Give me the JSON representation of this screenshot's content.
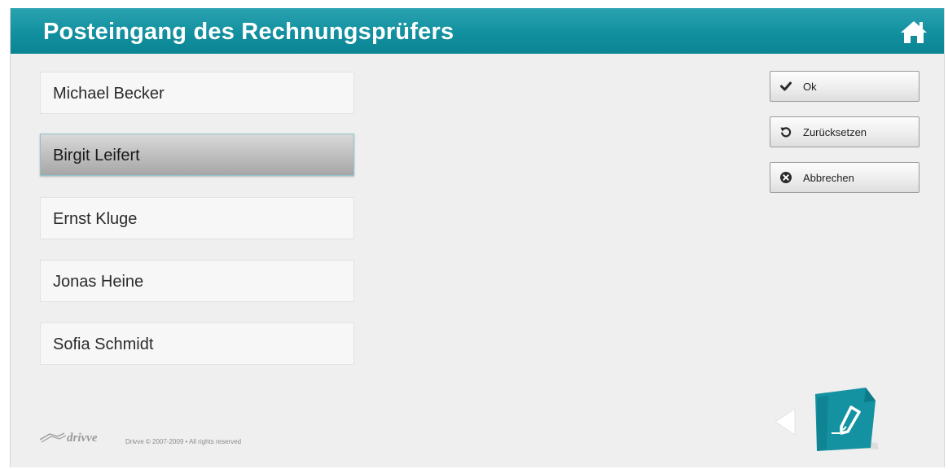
{
  "header": {
    "title": "Posteingang des Rechnungsprüfers",
    "accent_color": "#12909f",
    "home_icon": "home-icon"
  },
  "recipients": [
    {
      "name": "Michael Becker",
      "selected": false
    },
    {
      "name": "Birgit Leifert",
      "selected": true
    },
    {
      "name": "Ernst Kluge",
      "selected": false
    },
    {
      "name": "Jonas Heine",
      "selected": false
    },
    {
      "name": "Sofia Schmidt",
      "selected": false
    }
  ],
  "actions": {
    "ok": {
      "label": "Ok",
      "icon": "checkmark-icon"
    },
    "reset": {
      "label": "Zurücksetzen",
      "icon": "undo-icon"
    },
    "cancel": {
      "label": "Abbrechen",
      "icon": "close-circle-icon"
    }
  },
  "footer": {
    "brand": "drivve",
    "copyright": "Drivve © 2007-2009 • All rights reserved"
  },
  "navigation": {
    "back_icon": "back-arrow-icon",
    "app_icon": "document-pen-icon"
  }
}
